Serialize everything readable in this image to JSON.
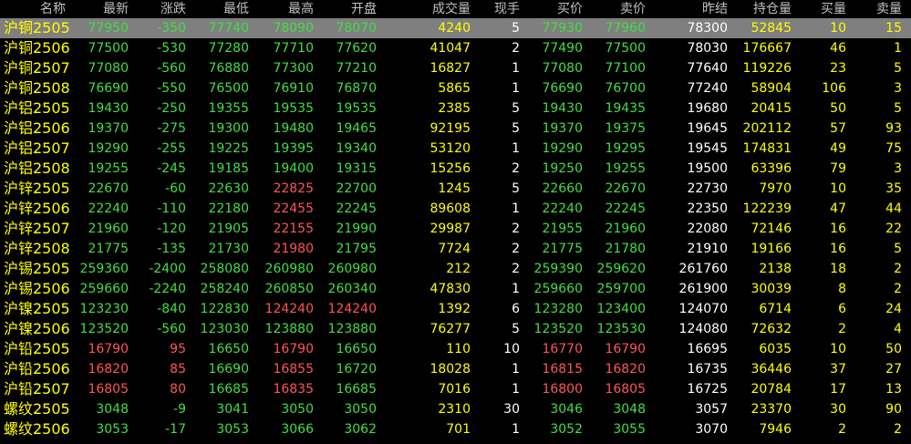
{
  "headers": {
    "name": "名称",
    "last": "最新",
    "change": "涨跌",
    "low": "最低",
    "high": "最高",
    "open": "开盘",
    "volume": "成交量",
    "current_hand": "现手",
    "bid": "买价",
    "ask": "卖价",
    "prev_settle": "昨结",
    "open_interest": "持仓量",
    "bid_vol": "买量",
    "ask_vol": "卖量"
  },
  "rows": [
    {
      "name": "沪铜2505",
      "last": "77950",
      "change": "-350",
      "low": "77740",
      "high": "78090",
      "open": "78070",
      "volume": "4240",
      "current_hand": "5",
      "bid": "77930",
      "ask": "77960",
      "prev_settle": "78300",
      "open_interest": "52845",
      "bid_vol": "10",
      "ask_vol": "15"
    },
    {
      "name": "沪铜2506",
      "last": "77500",
      "change": "-530",
      "low": "77280",
      "high": "77710",
      "open": "77620",
      "volume": "41047",
      "current_hand": "2",
      "bid": "77490",
      "ask": "77500",
      "prev_settle": "78030",
      "open_interest": "176667",
      "bid_vol": "46",
      "ask_vol": "1"
    },
    {
      "name": "沪铜2507",
      "last": "77080",
      "change": "-560",
      "low": "76880",
      "high": "77300",
      "open": "77210",
      "volume": "16827",
      "current_hand": "1",
      "bid": "77080",
      "ask": "77100",
      "prev_settle": "77640",
      "open_interest": "119226",
      "bid_vol": "23",
      "ask_vol": "5"
    },
    {
      "name": "沪铜2508",
      "last": "76690",
      "change": "-550",
      "low": "76500",
      "high": "76910",
      "open": "76870",
      "volume": "5865",
      "current_hand": "1",
      "bid": "76690",
      "ask": "76700",
      "prev_settle": "77240",
      "open_interest": "58904",
      "bid_vol": "106",
      "ask_vol": "3"
    },
    {
      "name": "沪铝2505",
      "last": "19430",
      "change": "-250",
      "low": "19355",
      "high": "19535",
      "open": "19535",
      "volume": "2385",
      "current_hand": "5",
      "bid": "19430",
      "ask": "19435",
      "prev_settle": "19680",
      "open_interest": "20415",
      "bid_vol": "50",
      "ask_vol": "5"
    },
    {
      "name": "沪铝2506",
      "last": "19370",
      "change": "-275",
      "low": "19300",
      "high": "19480",
      "open": "19465",
      "volume": "92195",
      "current_hand": "5",
      "bid": "19370",
      "ask": "19375",
      "prev_settle": "19645",
      "open_interest": "202112",
      "bid_vol": "57",
      "ask_vol": "93"
    },
    {
      "name": "沪铝2507",
      "last": "19290",
      "change": "-255",
      "low": "19225",
      "high": "19395",
      "open": "19340",
      "volume": "53120",
      "current_hand": "1",
      "bid": "19290",
      "ask": "19295",
      "prev_settle": "19545",
      "open_interest": "174831",
      "bid_vol": "49",
      "ask_vol": "75"
    },
    {
      "name": "沪铝2508",
      "last": "19255",
      "change": "-245",
      "low": "19185",
      "high": "19400",
      "open": "19315",
      "volume": "15256",
      "current_hand": "2",
      "bid": "19250",
      "ask": "19255",
      "prev_settle": "19500",
      "open_interest": "63396",
      "bid_vol": "79",
      "ask_vol": "3"
    },
    {
      "name": "沪锌2505",
      "last": "22670",
      "change": "-60",
      "low": "22630",
      "high": "22825",
      "open": "22700",
      "volume": "1245",
      "current_hand": "5",
      "bid": "22660",
      "ask": "22670",
      "prev_settle": "22730",
      "open_interest": "7970",
      "bid_vol": "10",
      "ask_vol": "35"
    },
    {
      "name": "沪锌2506",
      "last": "22240",
      "change": "-110",
      "low": "22180",
      "high": "22455",
      "open": "22245",
      "volume": "89608",
      "current_hand": "1",
      "bid": "22240",
      "ask": "22245",
      "prev_settle": "22350",
      "open_interest": "122239",
      "bid_vol": "47",
      "ask_vol": "44"
    },
    {
      "name": "沪锌2507",
      "last": "21960",
      "change": "-120",
      "low": "21905",
      "high": "22155",
      "open": "21990",
      "volume": "29987",
      "current_hand": "2",
      "bid": "21955",
      "ask": "21960",
      "prev_settle": "22080",
      "open_interest": "72146",
      "bid_vol": "16",
      "ask_vol": "22"
    },
    {
      "name": "沪锌2508",
      "last": "21775",
      "change": "-135",
      "low": "21730",
      "high": "21980",
      "open": "21795",
      "volume": "7724",
      "current_hand": "2",
      "bid": "21775",
      "ask": "21780",
      "prev_settle": "21910",
      "open_interest": "19166",
      "bid_vol": "16",
      "ask_vol": "5"
    },
    {
      "name": "沪锡2505",
      "last": "259360",
      "change": "-2400",
      "low": "258080",
      "high": "260980",
      "open": "260980",
      "volume": "212",
      "current_hand": "2",
      "bid": "259390",
      "ask": "259620",
      "prev_settle": "261760",
      "open_interest": "2138",
      "bid_vol": "18",
      "ask_vol": "2"
    },
    {
      "name": "沪锡2506",
      "last": "259660",
      "change": "-2240",
      "low": "258240",
      "high": "260850",
      "open": "260340",
      "volume": "47830",
      "current_hand": "1",
      "bid": "259660",
      "ask": "259700",
      "prev_settle": "261900",
      "open_interest": "30039",
      "bid_vol": "8",
      "ask_vol": "2"
    },
    {
      "name": "沪镍2505",
      "last": "123230",
      "change": "-840",
      "low": "122830",
      "high": "124240",
      "open": "124240",
      "volume": "1392",
      "current_hand": "6",
      "bid": "123280",
      "ask": "123400",
      "prev_settle": "124070",
      "open_interest": "6714",
      "bid_vol": "6",
      "ask_vol": "24"
    },
    {
      "name": "沪镍2506",
      "last": "123520",
      "change": "-560",
      "low": "123030",
      "high": "123880",
      "open": "123880",
      "volume": "76277",
      "current_hand": "5",
      "bid": "123520",
      "ask": "123530",
      "prev_settle": "124080",
      "open_interest": "72632",
      "bid_vol": "2",
      "ask_vol": "4"
    },
    {
      "name": "沪铅2505",
      "last": "16790",
      "change": "95",
      "low": "16650",
      "high": "16790",
      "open": "16650",
      "volume": "110",
      "current_hand": "10",
      "bid": "16770",
      "ask": "16790",
      "prev_settle": "16695",
      "open_interest": "6035",
      "bid_vol": "10",
      "ask_vol": "50"
    },
    {
      "name": "沪铅2506",
      "last": "16820",
      "change": "85",
      "low": "16690",
      "high": "16855",
      "open": "16720",
      "volume": "18028",
      "current_hand": "1",
      "bid": "16815",
      "ask": "16820",
      "prev_settle": "16735",
      "open_interest": "36446",
      "bid_vol": "37",
      "ask_vol": "27"
    },
    {
      "name": "沪铅2507",
      "last": "16805",
      "change": "80",
      "low": "16685",
      "high": "16835",
      "open": "16685",
      "volume": "7016",
      "current_hand": "1",
      "bid": "16800",
      "ask": "16805",
      "prev_settle": "16725",
      "open_interest": "20784",
      "bid_vol": "17",
      "ask_vol": "13"
    },
    {
      "name": "螺纹2505",
      "last": "3048",
      "change": "-9",
      "low": "3041",
      "high": "3050",
      "open": "3050",
      "volume": "2310",
      "current_hand": "30",
      "bid": "3046",
      "ask": "3048",
      "prev_settle": "3057",
      "open_interest": "23370",
      "bid_vol": "30",
      "ask_vol": "90"
    },
    {
      "name": "螺纹2506",
      "last": "3053",
      "change": "-17",
      "low": "3053",
      "high": "3066",
      "open": "3062",
      "volume": "701",
      "current_hand": "1",
      "bid": "3052",
      "ask": "3055",
      "prev_settle": "3070",
      "open_interest": "7946",
      "bid_vol": "2",
      "ask_vol": "2"
    }
  ],
  "colors": {
    "background": "#000000",
    "up": "#ff5555",
    "down": "#44dd44",
    "name": "#ffff00",
    "header": "#c0c0c0",
    "selected_row": "#7f7f7f"
  },
  "selected_row": 0
}
